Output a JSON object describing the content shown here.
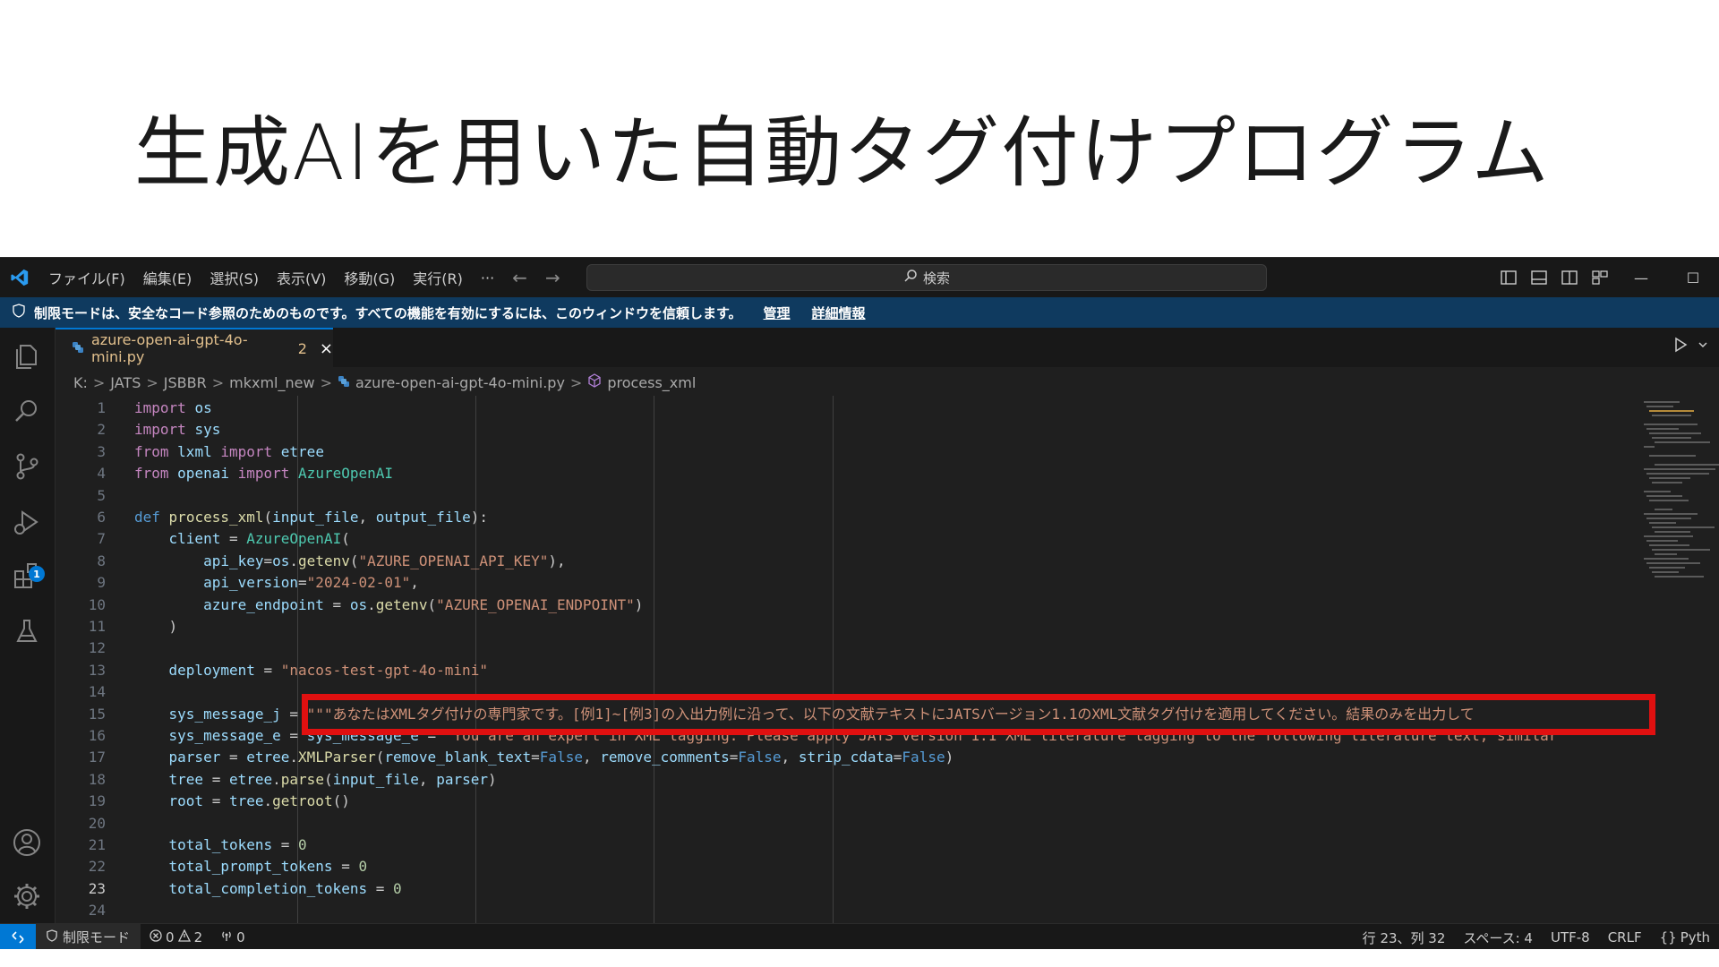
{
  "slide": {
    "title": "生成AIを用いた自動タグ付けプログラム"
  },
  "titlebar": {
    "menus": [
      "ファイル(F)",
      "編集(E)",
      "選択(S)",
      "表示(V)",
      "移動(G)",
      "実行(R)",
      "···"
    ],
    "search_placeholder": "検索",
    "minimize": "—",
    "maximize": "☐"
  },
  "banner": {
    "text": "制限モードは、安全なコード参照のためのものです。すべての機能を有効にするには、このウィンドウを信頼します。",
    "manage": "管理",
    "details": "詳細情報"
  },
  "activity": {
    "extensions_badge": "1"
  },
  "tab": {
    "filename": "azure-open-ai-gpt-4o-mini.py",
    "problems": "2",
    "close": "×"
  },
  "breadcrumb": [
    "K:",
    "JATS",
    "JSBBR",
    "mkxml_new",
    "azure-open-ai-gpt-4o-mini.py",
    "process_xml"
  ],
  "code_lines": [
    {
      "n": "1",
      "text": "import os"
    },
    {
      "n": "2",
      "text": "import sys"
    },
    {
      "n": "3",
      "text": "from lxml import etree"
    },
    {
      "n": "4",
      "text": "from openai import AzureOpenAI"
    },
    {
      "n": "5",
      "text": ""
    },
    {
      "n": "6",
      "text": "def process_xml(input_file, output_file):"
    },
    {
      "n": "7",
      "text": "    client = AzureOpenAI("
    },
    {
      "n": "8",
      "text": "        api_key=os.getenv(\"AZURE_OPENAI_API_KEY\"),"
    },
    {
      "n": "9",
      "text": "        api_version=\"2024-02-01\","
    },
    {
      "n": "10",
      "text": "        azure_endpoint = os.getenv(\"AZURE_OPENAI_ENDPOINT\")"
    },
    {
      "n": "11",
      "text": "    )"
    },
    {
      "n": "12",
      "text": ""
    },
    {
      "n": "13",
      "text": "    deployment = \"nacos-test-gpt-4o-mini\""
    },
    {
      "n": "14",
      "text": ""
    },
    {
      "n": "15",
      "text": "    sys_message_j = \"\"\"あなたはXMLタグ付けの専門家です。[例1]~[例3]の入出力例に沿って、以下の文献テキストにJATSバージョン1.1のXML文献タグ付けを適用してください。結果のみを出力して"
    },
    {
      "n": "16",
      "text": "    sys_message_e = sys_message_e = \"You are an expert in XML tagging. Please apply JATS version 1.1 XML literature tagging to the following literature text, similar"
    },
    {
      "n": "17",
      "text": "    parser = etree.XMLParser(remove_blank_text=False, remove_comments=False, strip_cdata=False)"
    },
    {
      "n": "18",
      "text": "    tree = etree.parse(input_file, parser)"
    },
    {
      "n": "19",
      "text": "    root = tree.getroot()"
    },
    {
      "n": "20",
      "text": ""
    },
    {
      "n": "21",
      "text": "    total_tokens = 0"
    },
    {
      "n": "22",
      "text": "    total_prompt_tokens = 0"
    },
    {
      "n": "23",
      "text": "    total_completion_tokens = 0"
    },
    {
      "n": "24",
      "text": ""
    }
  ],
  "statusbar": {
    "restricted": "制限モード",
    "errors": "0",
    "warnings": "2",
    "ports": "0",
    "position": "行 23、列 32",
    "spaces": "スペース: 4",
    "encoding": "UTF-8",
    "eol": "CRLF",
    "language": "Pyth"
  },
  "colors": {
    "accent": "#0078d4",
    "banner": "#0f3a5f",
    "highlight": "#e01010"
  }
}
